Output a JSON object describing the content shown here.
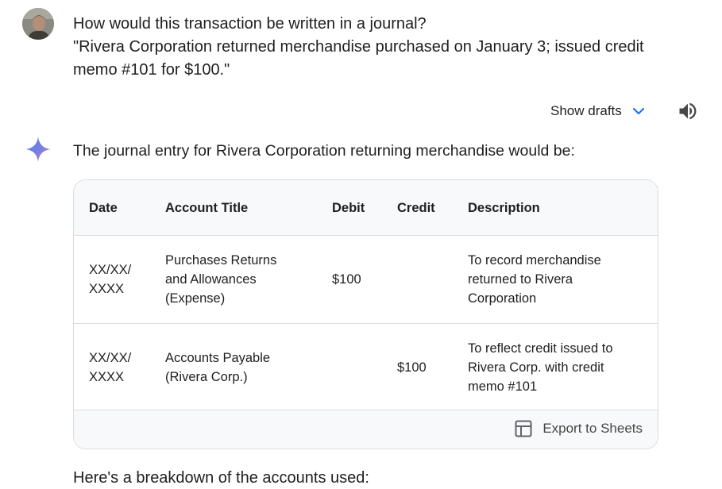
{
  "prompt": {
    "line1": "How would this transaction be written in a journal?",
    "line2": "\"Rivera Corporation returned merchandise purchased on January 3; issued credit memo #101 for $100.\""
  },
  "controls": {
    "show_drafts_label": "Show drafts",
    "icons": {
      "drafts": "chevron-down-icon",
      "audio": "speaker-icon",
      "export": "table-icon"
    },
    "accent_color": "#1a73e8"
  },
  "answer": {
    "intro": "The journal entry for Rivera Corporation returning merchandise would be:",
    "table": {
      "headers": [
        "Date",
        "Account Title",
        "Debit",
        "Credit",
        "Description"
      ],
      "rows": [
        [
          "XX/XX/\nXXXX",
          "Purchases Returns and Allowances (Expense)",
          "$100",
          "",
          "To record merchandise returned to Rivera Corporation"
        ],
        [
          "XX/XX/\nXXXX",
          "Accounts Payable (Rivera Corp.)",
          "",
          "$100",
          "To reflect credit issued to Rivera Corp. with credit memo #101"
        ]
      ]
    },
    "export_label": "Export to Sheets",
    "followup_partial": "Here's a breakdown of the accounts used:"
  }
}
